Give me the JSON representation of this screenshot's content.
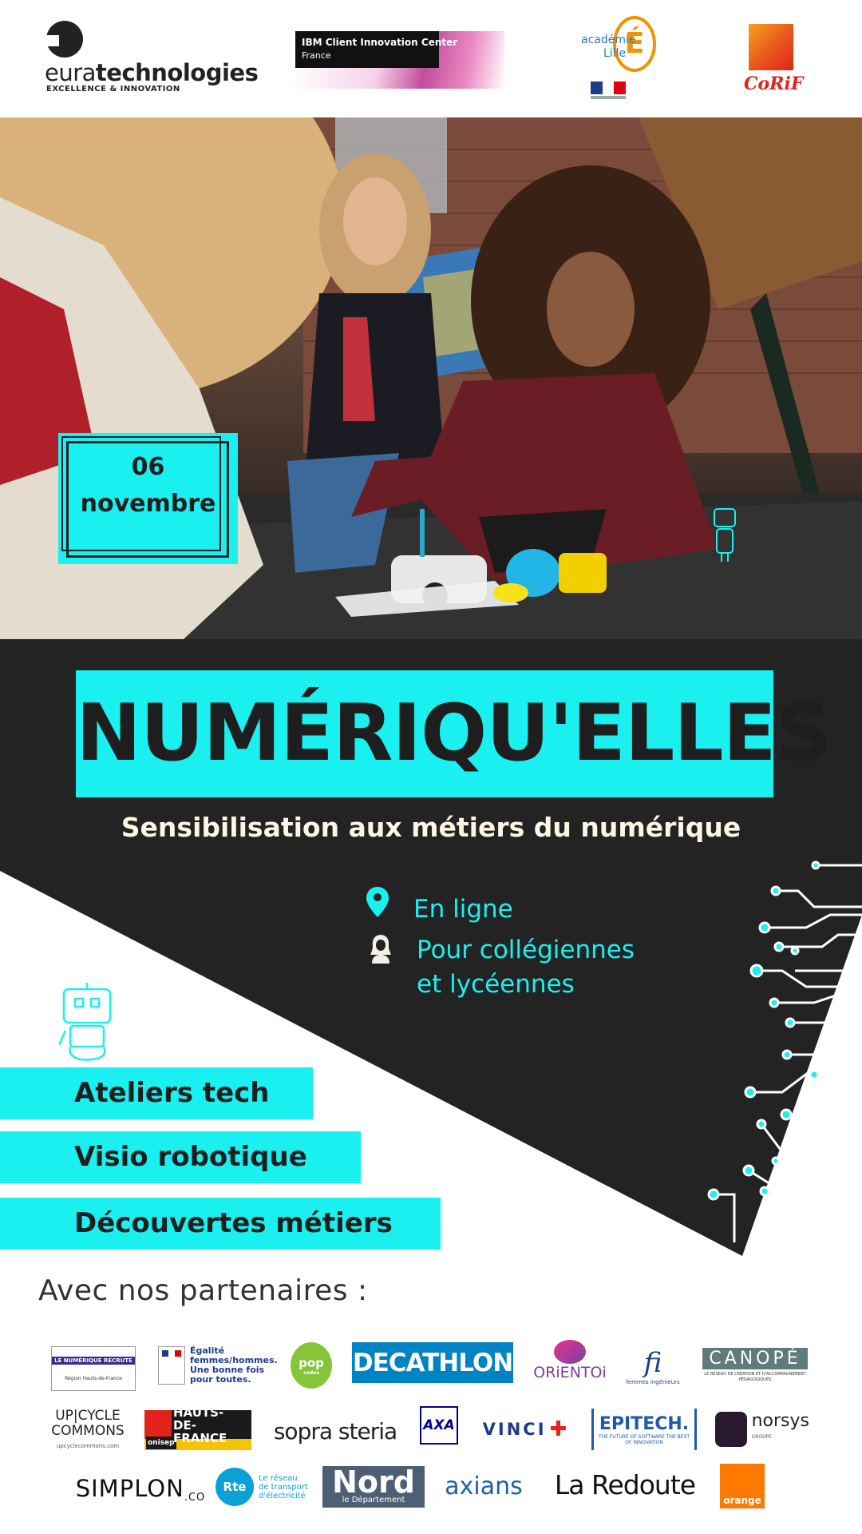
{
  "header": {
    "eura": {
      "word_light": "eura",
      "word_bold": "technologies",
      "tagline": "EXCELLENCE & INNOVATION"
    },
    "ibm": {
      "title": "IBM Client Innovation Center",
      "subtitle": "France"
    },
    "academie": {
      "line1": "académie",
      "line2": "Lille",
      "letter": "É"
    },
    "corif": {
      "name": "CoRiF"
    }
  },
  "date": {
    "day": "06",
    "month": "novembre"
  },
  "title": "NUMÉRIQU'ELLES",
  "subtitle": "Sensibilisation aux métiers du numérique",
  "info": {
    "location": "En ligne",
    "audience_line1": "Pour collégiennes",
    "audience_line2": "et lycéennes"
  },
  "activities": [
    "Ateliers tech",
    "Visio robotique",
    "Découvertes métiers"
  ],
  "partners_title": "Avec nos partenaires :",
  "partners": {
    "row1": [
      "LE NUMÉRIQUE RECRUTE",
      "Égalité femmes/hommes. Une bonne fois pour toutes.",
      "pop",
      "DECATHLON",
      "ORiENTOi",
      "fi",
      "CANOPÉ"
    ],
    "row1_extra": {
      "fi_caption": "femmes ingénieurs",
      "canope_caption": "LE RÉSEAU DE CRÉATION ET D'ACCOMPAGNEMENT PÉDAGOGIQUES",
      "region": "Région Hauts-de-France",
      "pop_sub": "codes"
    },
    "row2": [
      "UP|CYCLE COMMONS",
      "HAUTS-DE-FRANCE",
      "sopra steria",
      "AXA",
      "VINCI",
      "EPITECH.",
      "norsys"
    ],
    "row2_extra": {
      "upcycle_url": "upcyclecommons.com",
      "onisep": "onisep",
      "epitech_tag": "THE FUTURE OF SOFTWARE THE BEST OF INNOVATION",
      "norsys_sub": "GROUPE"
    },
    "row3": [
      "SIMPLON",
      "Le réseau de transport d'électricité",
      "Nord",
      "axians",
      "La Redoute",
      "orange"
    ],
    "row3_extra": {
      "simplon_co": ".CO",
      "rte": "Rte",
      "nord_sub": "le Département"
    }
  },
  "colors": {
    "accent": "#19f0ef",
    "dark": "#232323",
    "cream": "#fdf6e4",
    "decathlon": "#0082c3",
    "orange": "#ff7900",
    "nord": "#4d5f74"
  }
}
